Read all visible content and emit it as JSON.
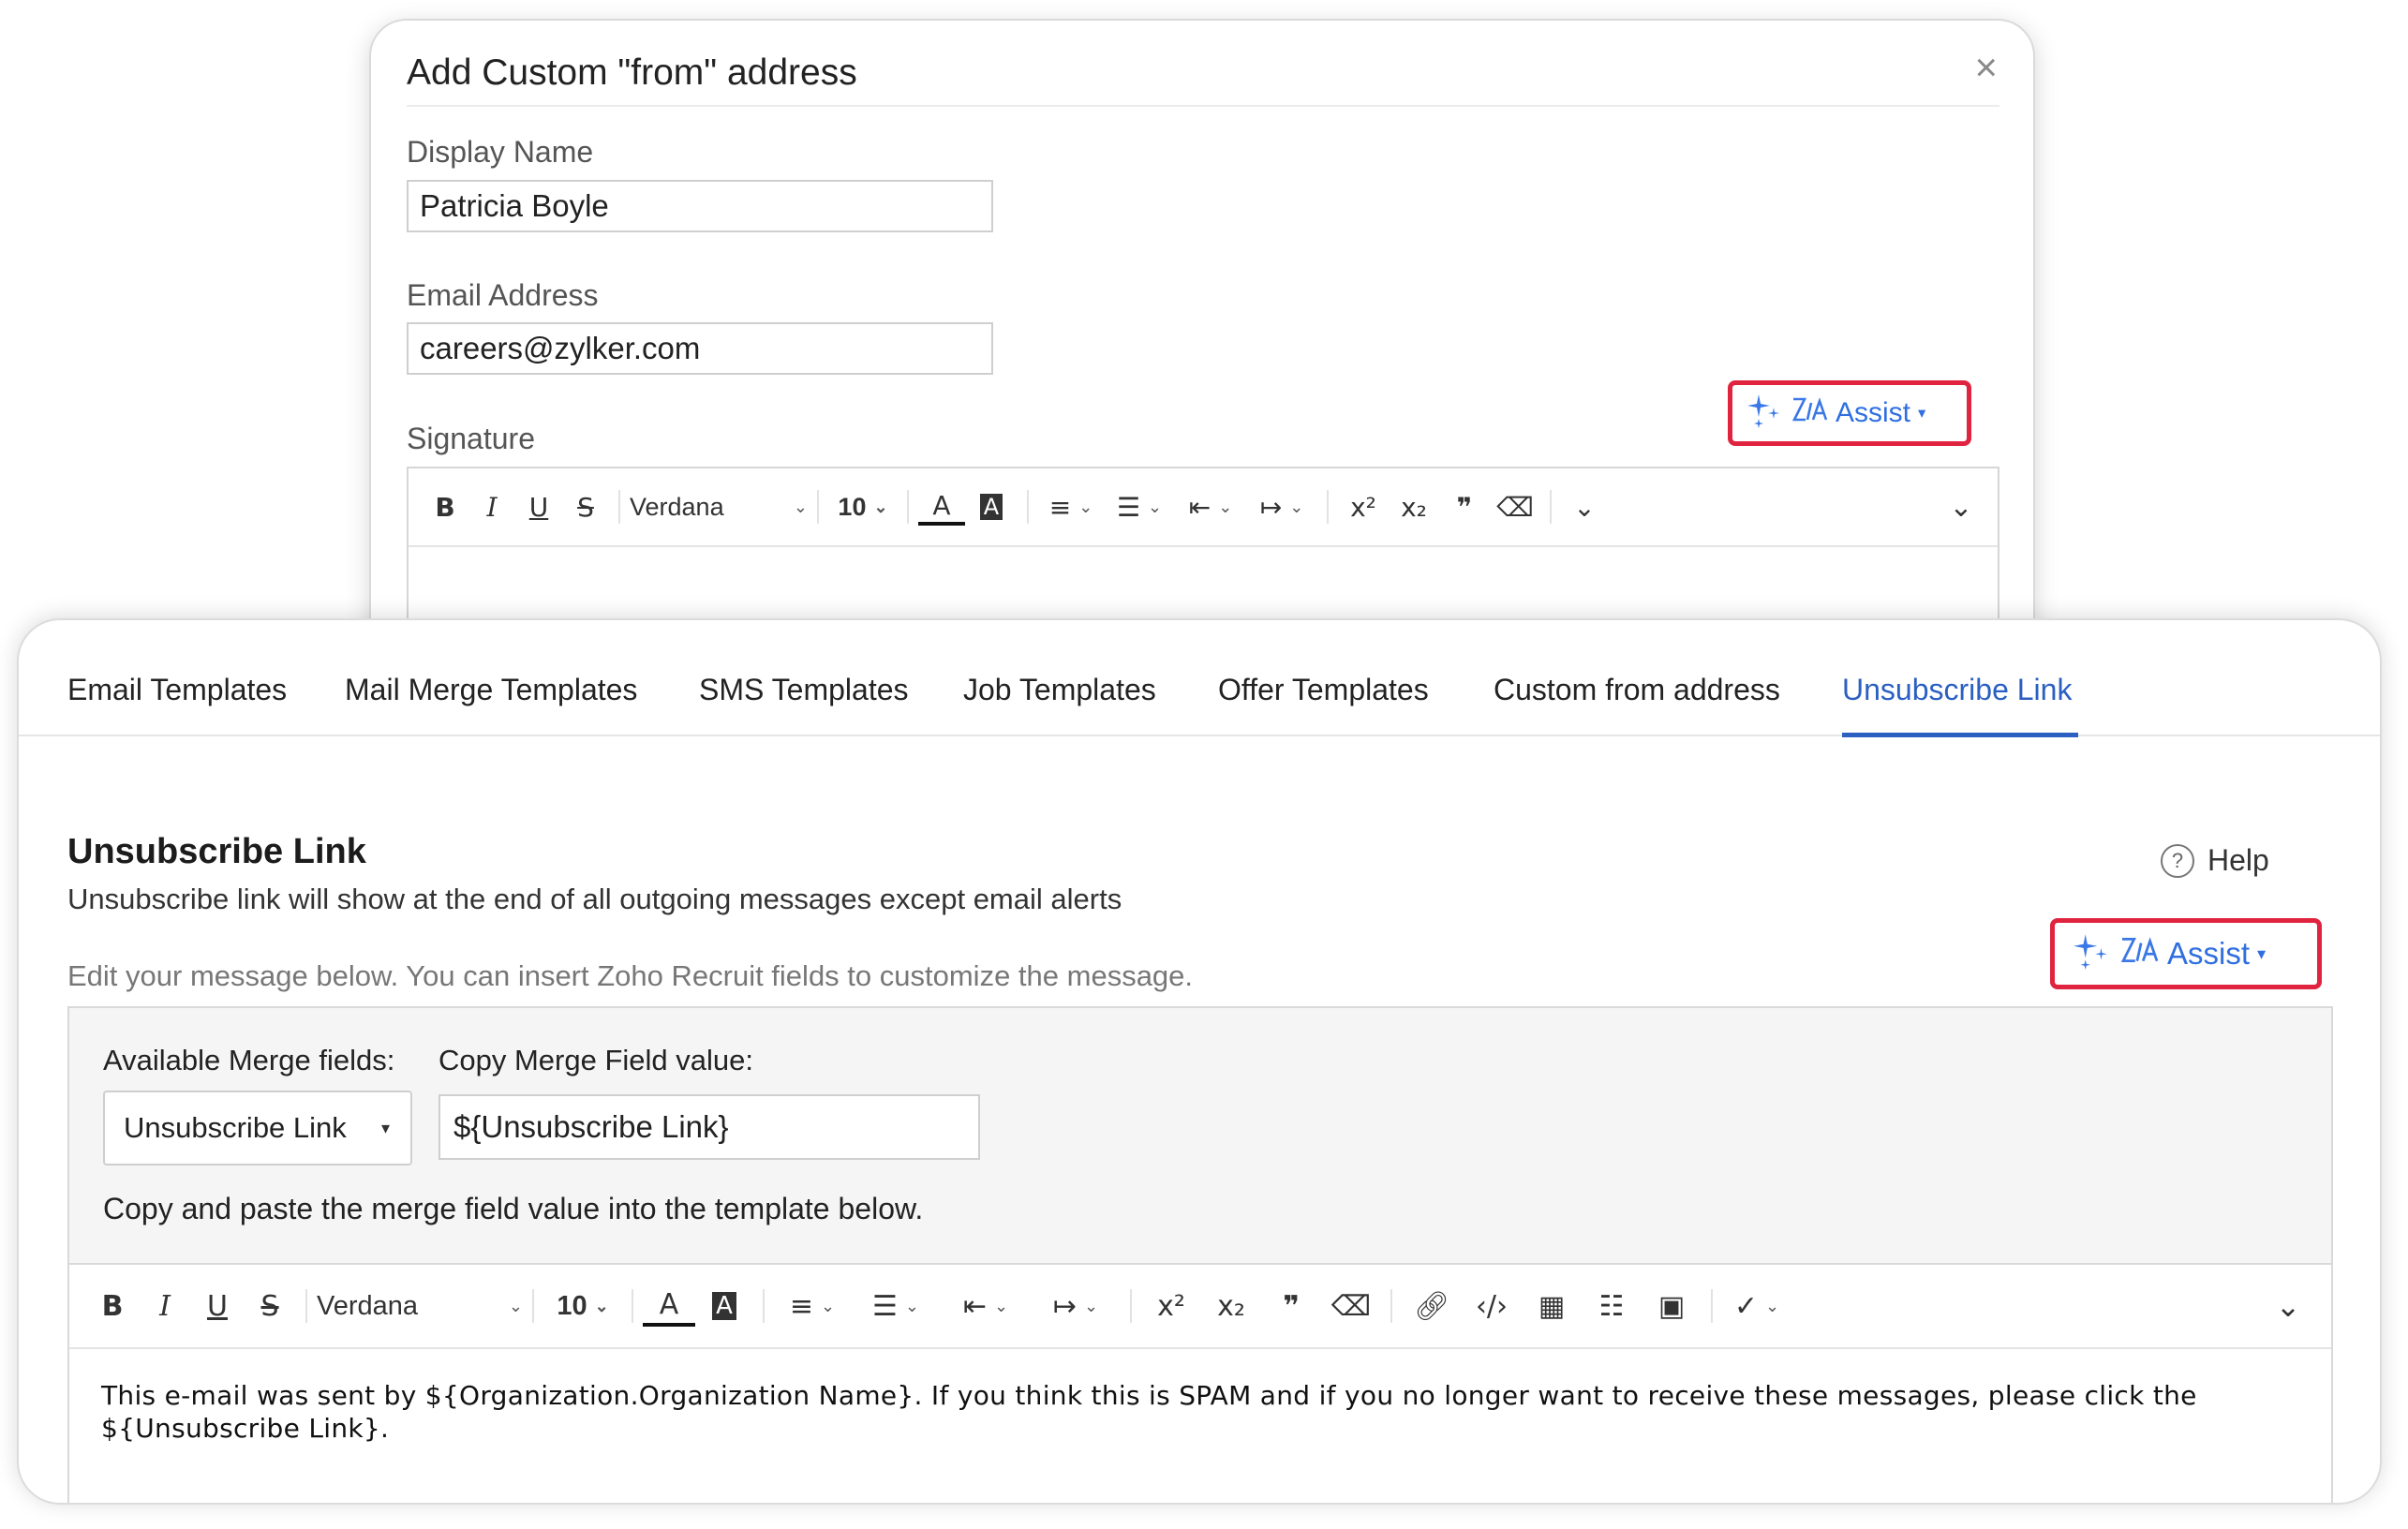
{
  "dialog": {
    "title": "Add Custom \"from\" address",
    "close_symbol": "×",
    "display_name_label": "Display Name",
    "display_name_value": "Patricia Boyle",
    "email_label": "Email Address",
    "email_value": "careers@zylker.com",
    "signature_label": "Signature",
    "assist": {
      "label": "Assist",
      "caret": "▾"
    },
    "toolbar": {
      "font_family": "Verdana",
      "font_size": "10"
    }
  },
  "tabs": [
    {
      "label": "Email Templates"
    },
    {
      "label": "Mail Merge Templates"
    },
    {
      "label": "SMS Templates"
    },
    {
      "label": "Job Templates"
    },
    {
      "label": "Offer Templates"
    },
    {
      "label": "Custom from address"
    },
    {
      "label": "Unsubscribe Link",
      "active": true
    }
  ],
  "section": {
    "title": "Unsubscribe Link",
    "description": "Unsubscribe link will show at the end of all outgoing messages except email alerts",
    "hint": "Edit your message below. You can insert Zoho Recruit fields to customize the message.",
    "help_label": "Help",
    "help_icon_symbol": "?",
    "assist": {
      "label": "Assist",
      "caret": "▾"
    }
  },
  "merge": {
    "available_label": "Available Merge fields:",
    "copy_label": "Copy Merge Field value:",
    "selected_field": "Unsubscribe Link",
    "caret": "▾",
    "field_value": "${Unsubscribe Link}",
    "copy_note": "Copy and paste the merge field value into the template below."
  },
  "editor": {
    "toolbar": {
      "font_family": "Verdana",
      "font_size": "10"
    },
    "content_line1": "This e-mail was sent by ${Organization.Organization Name}. If you think this is SPAM and if you no longer want to receive these messages, please click the",
    "content_line2": "${Unsubscribe Link}."
  },
  "colors": {
    "accent_blue": "#2b5fc2",
    "assist_blue": "#2f6fe0",
    "highlight_red": "#e0243f"
  }
}
